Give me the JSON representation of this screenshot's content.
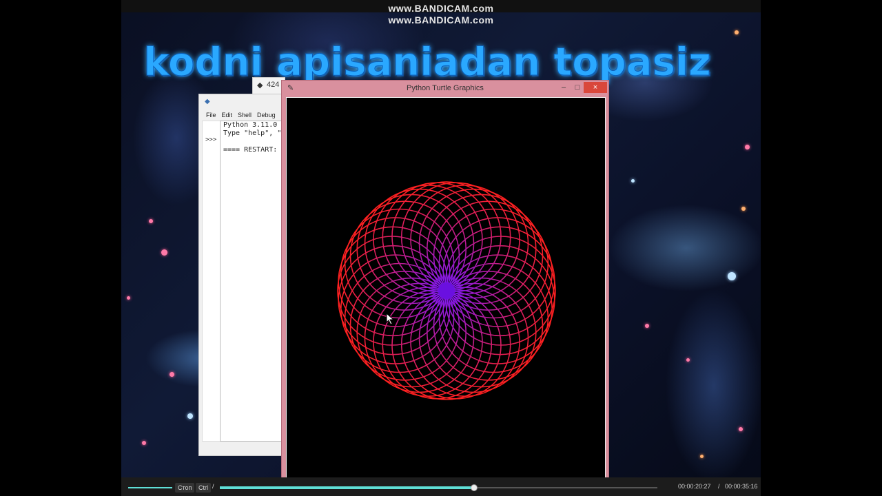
{
  "watermark": {
    "line1": "www.BANDICAM.com",
    "line2": "www.BANDICAM.com"
  },
  "headline": "kodni apisaniadan topasiz",
  "idle_shell": {
    "menu": [
      "File",
      "Edit",
      "Shell",
      "Debug"
    ],
    "prompt": ">>>",
    "lines": [
      "Python 3.11.0 (",
      "Type \"help\", \"c",
      "",
      "==== RESTART: C"
    ],
    "second_window_title": "424"
  },
  "turtle_window": {
    "title": "Python Turtle Graphics",
    "minimize": "–",
    "maximize": "□",
    "close": "×",
    "colors": {
      "outer": "#ff2020",
      "inner": "#7a18ff",
      "center": "#6a10e0"
    }
  },
  "player": {
    "key1": "Стоп",
    "key2": "Ctrl",
    "separator": "/",
    "progress_fraction": 0.58,
    "current_time": "00:00:20:27",
    "slash": "/",
    "total_time": "00:00:35:16"
  }
}
